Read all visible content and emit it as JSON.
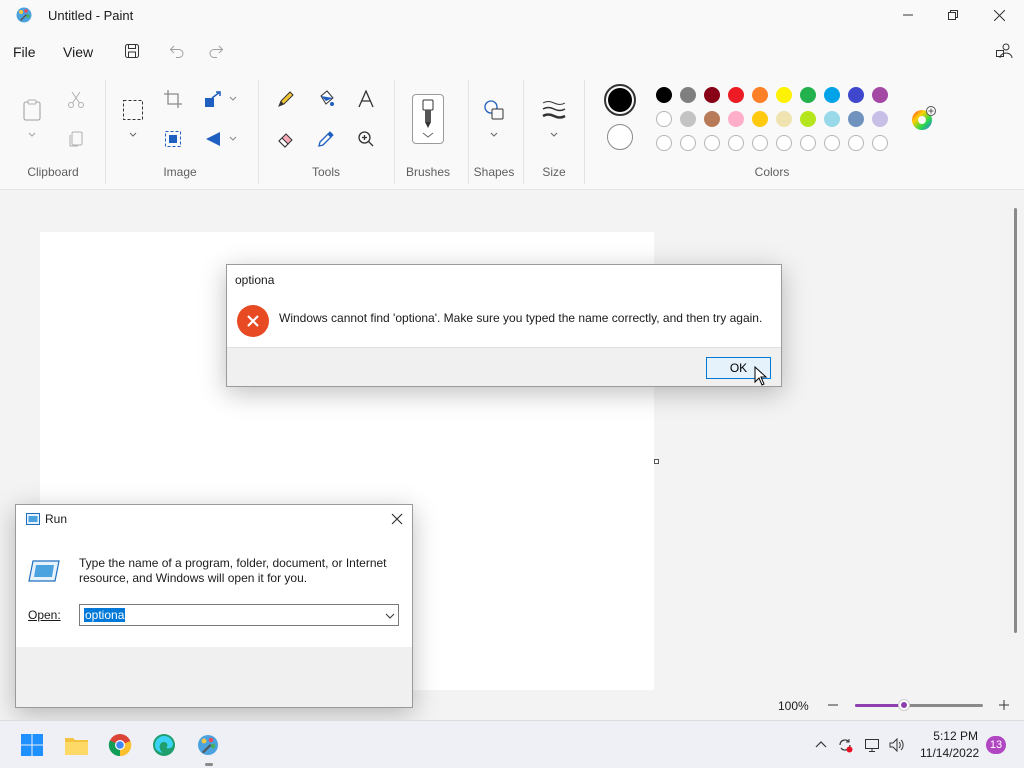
{
  "window": {
    "title": "Untitled - Paint"
  },
  "menu": {
    "file": "File",
    "view": "View"
  },
  "ribbon": {
    "groups": {
      "clipboard": "Clipboard",
      "image": "Image",
      "tools": "Tools",
      "brushes": "Brushes",
      "shapes": "Shapes",
      "size": "Size",
      "colors": "Colors"
    },
    "palette_row1": [
      "#000000",
      "#7f7f7f",
      "#880015",
      "#ed1c24",
      "#ff7f27",
      "#fff200",
      "#22b14c",
      "#00a2e8",
      "#3f48cc",
      "#a349a4"
    ],
    "palette_row2": [
      "#ffffff",
      "#c3c3c3",
      "#b97a57",
      "#ffaec9",
      "#ffc90e",
      "#efe4b0",
      "#b5e61d",
      "#99d9ea",
      "#7092be",
      "#c8bfe7"
    ],
    "palette_row3_count": 10,
    "primary_color": "#000000",
    "secondary_color": "#ffffff"
  },
  "status": {
    "zoom": "100%",
    "zoom_fraction": 0.38
  },
  "error_dialog": {
    "title": "optiona",
    "message": "Windows cannot find 'optiona'. Make sure you typed the name correctly, and then try again.",
    "ok": "OK"
  },
  "run_dialog": {
    "title": "Run",
    "description": "Type the name of a program, folder, document, or Internet resource, and Windows will open it for you.",
    "open_label": "Open:",
    "input_value": "optiona"
  },
  "taskbar": {
    "time": "5:12 PM",
    "date": "11/14/2022",
    "notifications": "13"
  }
}
